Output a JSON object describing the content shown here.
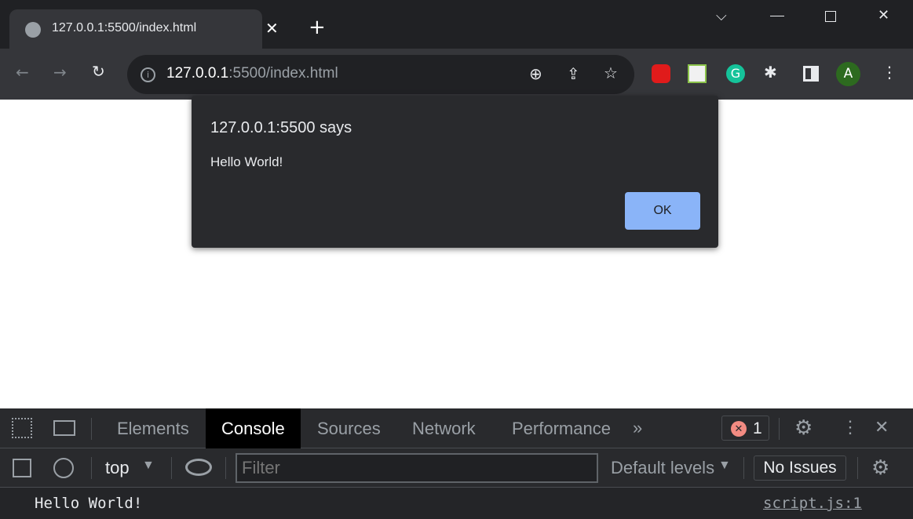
{
  "browser": {
    "tab_title": "127.0.0.1:5500/index.html",
    "url_host": "127.0.0.1",
    "url_rest": ":5500/index.html",
    "profile_initial": "A"
  },
  "dialog": {
    "title": "127.0.0.1:5500 says",
    "message": "Hello World!",
    "ok_label": "OK"
  },
  "devtools": {
    "tabs": [
      "Elements",
      "Console",
      "Sources",
      "Network",
      "Performance"
    ],
    "active_tab": "Console",
    "error_count": "1",
    "context": "top",
    "filter_placeholder": "Filter",
    "levels": "Default levels",
    "issues": "No Issues",
    "log": {
      "message": "Hello World!",
      "source": "script.js:1"
    }
  },
  "colors": {
    "accent": "#8ab4f8",
    "error": "#f28b82",
    "profile": "#2d6a1f"
  }
}
